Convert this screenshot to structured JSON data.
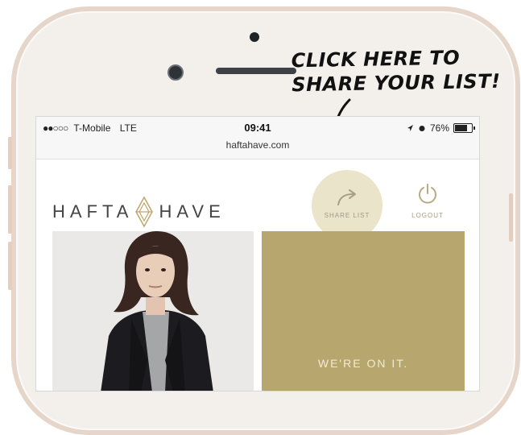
{
  "annotation": {
    "line1": "CLICK HERE TO",
    "line2": "SHARE YOUR LIST!"
  },
  "statusbar": {
    "signal_dots": "●●○○○",
    "carrier": "T-Mobile",
    "network": "LTE",
    "time": "09:41",
    "url": "haftahave.com",
    "battery_percent": "76%",
    "battery_level": 0.76
  },
  "header": {
    "logo_left": "HAFTA",
    "logo_right": "HAVE",
    "share_label": "SHARE LIST",
    "logout_label": "LOGOUT"
  },
  "cards": {
    "gold_text": "WE'RE ON IT."
  },
  "colors": {
    "gold": "#b7a66d",
    "phone_frame": "#e6d5c9",
    "share_highlight": "#e3dbba"
  }
}
